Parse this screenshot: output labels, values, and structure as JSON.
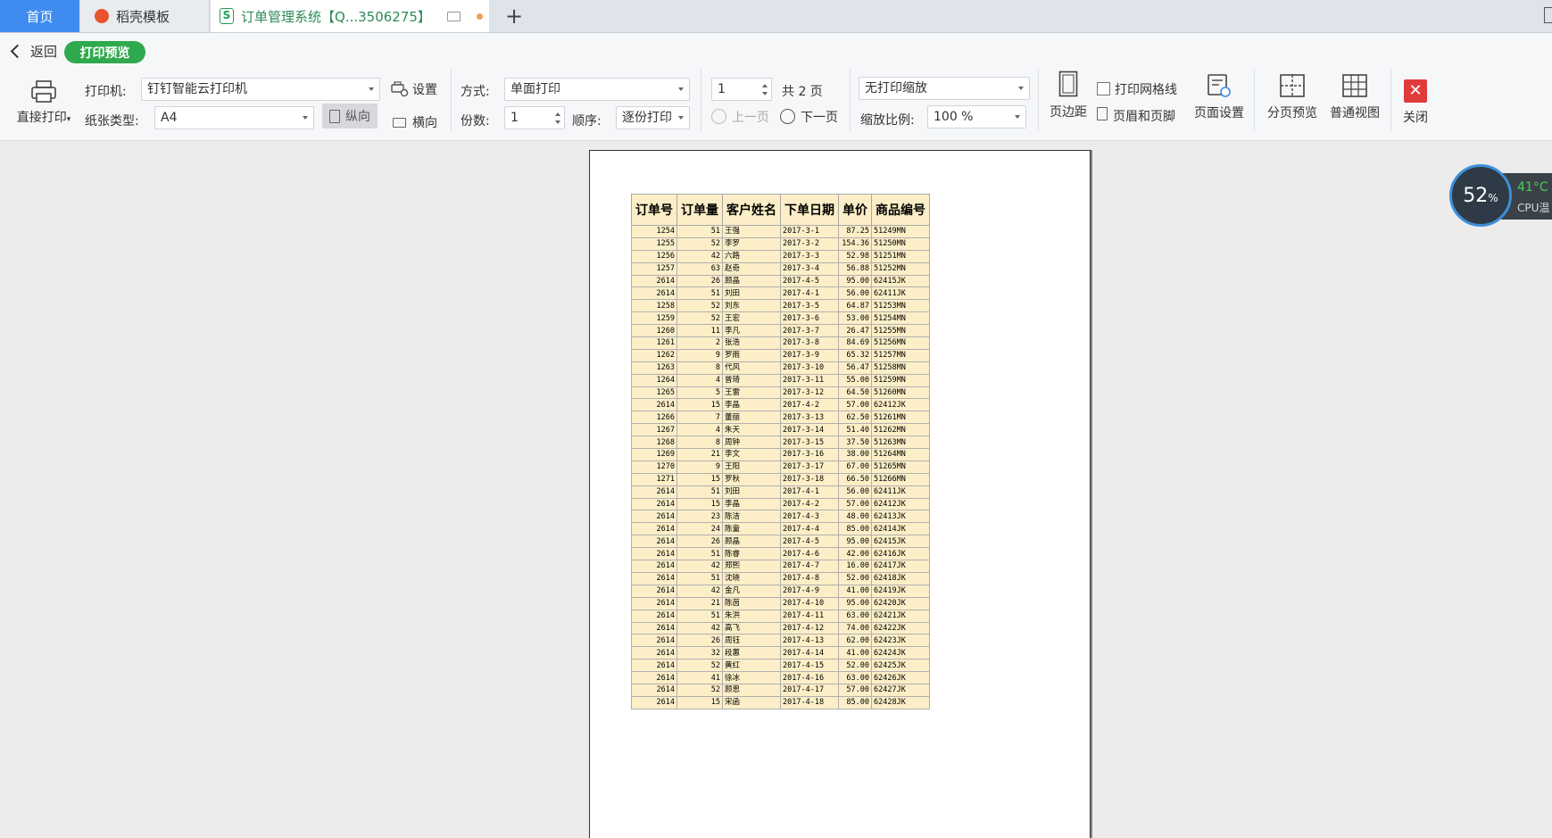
{
  "tabs": {
    "home": "首页",
    "template": "稻壳模板",
    "document": "订单管理系统【Q...3506275】"
  },
  "toolbar": {
    "back": "返回",
    "preview_badge": "打印预览",
    "direct_print": "直接打印",
    "printer_label": "打印机:",
    "printer_value": "钉钉智能云打印机",
    "settings": "设置",
    "paper_type_label": "纸张类型:",
    "paper_type_value": "A4",
    "portrait": "纵向",
    "landscape": "横向",
    "mode_label": "方式:",
    "mode_value": "单面打印",
    "copies_label": "份数:",
    "copies_value": "1",
    "order_label": "顺序:",
    "order_value": "逐份打印",
    "page_value": "1",
    "total_pages": "共 2 页",
    "prev_page": "上一页",
    "next_page": "下一页",
    "scale_mode_value": "无打印缩放",
    "scale_label": "缩放比例:",
    "scale_value": "100 %",
    "margins": "页边距",
    "print_gridlines": "打印网格线",
    "header_footer": "页眉和页脚",
    "page_setup": "页面设置",
    "page_break_preview": "分页预览",
    "normal_view": "普通视图",
    "close": "关闭"
  },
  "sheet": {
    "headers": [
      "订单号",
      "订单量",
      "客户姓名",
      "下单日期",
      "单价",
      "商品编号"
    ],
    "rows": [
      [
        "1254",
        "51",
        "王强",
        "2017-3-1",
        "87.25",
        "51249MN"
      ],
      [
        "1255",
        "52",
        "李罗",
        "2017-3-2",
        "154.36",
        "51250MN"
      ],
      [
        "1256",
        "42",
        "六路",
        "2017-3-3",
        "52.98",
        "51251MN"
      ],
      [
        "1257",
        "63",
        "赵奇",
        "2017-3-4",
        "56.88",
        "51252MN"
      ],
      [
        "2614",
        "26",
        "顾晶",
        "2017-4-5",
        "95.00",
        "62415JK"
      ],
      [
        "2614",
        "51",
        "刘田",
        "2017-4-1",
        "56.00",
        "62411JK"
      ],
      [
        "1258",
        "52",
        "刘东",
        "2017-3-5",
        "64.87",
        "51253MN"
      ],
      [
        "1259",
        "52",
        "王宏",
        "2017-3-6",
        "53.00",
        "51254MN"
      ],
      [
        "1260",
        "11",
        "李凡",
        "2017-3-7",
        "26.47",
        "51255MN"
      ],
      [
        "1261",
        "2",
        "张浩",
        "2017-3-8",
        "84.69",
        "51256MN"
      ],
      [
        "1262",
        "9",
        "罗雨",
        "2017-3-9",
        "65.32",
        "51257MN"
      ],
      [
        "1263",
        "8",
        "代风",
        "2017-3-10",
        "56.47",
        "51258MN"
      ],
      [
        "1264",
        "4",
        "曾琦",
        "2017-3-11",
        "55.00",
        "51259MN"
      ],
      [
        "1265",
        "5",
        "王雷",
        "2017-3-12",
        "64.50",
        "51260MN"
      ],
      [
        "2614",
        "15",
        "李晶",
        "2017-4-2",
        "57.00",
        "62412JK"
      ],
      [
        "1266",
        "7",
        "董丽",
        "2017-3-13",
        "62.50",
        "51261MN"
      ],
      [
        "1267",
        "4",
        "朱天",
        "2017-3-14",
        "51.40",
        "51262MN"
      ],
      [
        "1268",
        "8",
        "周钟",
        "2017-3-15",
        "37.50",
        "51263MN"
      ],
      [
        "1269",
        "21",
        "李文",
        "2017-3-16",
        "38.00",
        "51264MN"
      ],
      [
        "1270",
        "9",
        "王阳",
        "2017-3-17",
        "67.00",
        "51265MN"
      ],
      [
        "1271",
        "15",
        "罗秋",
        "2017-3-18",
        "66.50",
        "51266MN"
      ],
      [
        "2614",
        "51",
        "刘田",
        "2017-4-1",
        "56.00",
        "62411JK"
      ],
      [
        "2614",
        "15",
        "李晶",
        "2017-4-2",
        "57.00",
        "62412JK"
      ],
      [
        "2614",
        "23",
        "陈洁",
        "2017-4-3",
        "48.00",
        "62413JK"
      ],
      [
        "2614",
        "24",
        "陈童",
        "2017-4-4",
        "85.00",
        "62414JK"
      ],
      [
        "2614",
        "26",
        "顾晶",
        "2017-4-5",
        "95.00",
        "62415JK"
      ],
      [
        "2614",
        "51",
        "陈睿",
        "2017-4-6",
        "42.00",
        "62416JK"
      ],
      [
        "2614",
        "42",
        "郑熙",
        "2017-4-7",
        "16.00",
        "62417JK"
      ],
      [
        "2614",
        "51",
        "沈晓",
        "2017-4-8",
        "52.00",
        "62418JK"
      ],
      [
        "2614",
        "42",
        "金凡",
        "2017-4-9",
        "41.00",
        "62419JK"
      ],
      [
        "2614",
        "21",
        "陈茵",
        "2017-4-10",
        "95.00",
        "62420JK"
      ],
      [
        "2614",
        "51",
        "朱洪",
        "2017-4-11",
        "63.00",
        "62421JK"
      ],
      [
        "2614",
        "42",
        "高飞",
        "2017-4-12",
        "74.00",
        "62422JK"
      ],
      [
        "2614",
        "26",
        "周钰",
        "2017-4-13",
        "62.00",
        "62423JK"
      ],
      [
        "2614",
        "32",
        "段蕙",
        "2017-4-14",
        "41.00",
        "62424JK"
      ],
      [
        "2614",
        "52",
        "黄红",
        "2017-4-15",
        "52.00",
        "62425JK"
      ],
      [
        "2614",
        "41",
        "徐冰",
        "2017-4-16",
        "63.00",
        "62426JK"
      ],
      [
        "2614",
        "52",
        "顾思",
        "2017-4-17",
        "57.00",
        "62427JK"
      ],
      [
        "2614",
        "15",
        "宋函",
        "2017-4-18",
        "85.00",
        "62428JK"
      ]
    ]
  },
  "cpu_widget": {
    "percent": "52",
    "percent_unit": "%",
    "temperature": "41°C",
    "label": "CPU温"
  }
}
